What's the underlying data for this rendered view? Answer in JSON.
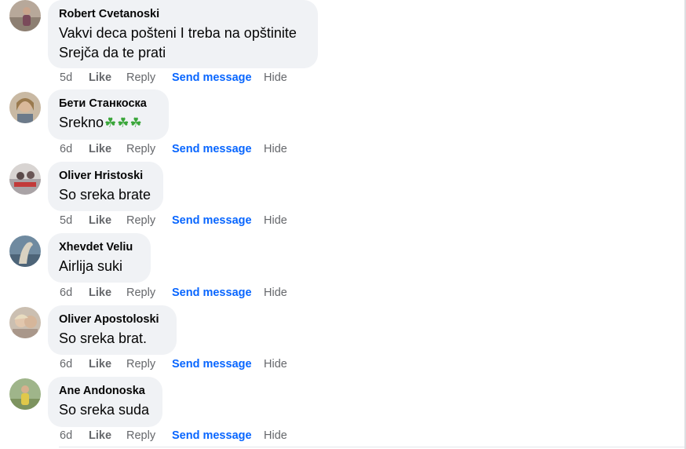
{
  "colors": {
    "bubble_bg": "#f0f2f5",
    "meta_text": "#65676b",
    "link_blue": "#0866ff"
  },
  "comments": [
    {
      "author": "Robert Cvetanoski",
      "lines": [
        "Vakvi deca pošteni I treba na opštinite",
        "Srejča da te prati"
      ],
      "time": "5d",
      "actions": {
        "like": "Like",
        "reply": "Reply",
        "send": "Send message",
        "hide": "Hide"
      }
    },
    {
      "author": "Бети Станкоска",
      "lines": [
        "Srekno"
      ],
      "emoji": [
        "☘",
        "☘",
        "☘"
      ],
      "emoji_names": "four-leaf-clover-icon",
      "time": "6d",
      "actions": {
        "like": "Like",
        "reply": "Reply",
        "send": "Send message",
        "hide": "Hide"
      }
    },
    {
      "author": "Oliver Hristoski",
      "lines": [
        "So sreka brate"
      ],
      "time": "5d",
      "actions": {
        "like": "Like",
        "reply": "Reply",
        "send": "Send message",
        "hide": "Hide"
      }
    },
    {
      "author": "Xhevdet Veliu",
      "lines": [
        "Airlija suki"
      ],
      "time": "6d",
      "actions": {
        "like": "Like",
        "reply": "Reply",
        "send": "Send message",
        "hide": "Hide"
      }
    },
    {
      "author": "Oliver Apostoloski",
      "lines": [
        "So sreka brat."
      ],
      "time": "6d",
      "actions": {
        "like": "Like",
        "reply": "Reply",
        "send": "Send message",
        "hide": "Hide"
      }
    },
    {
      "author": "Ane Andonoska",
      "lines": [
        "So sreka suda"
      ],
      "time": "6d",
      "actions": {
        "like": "Like",
        "reply": "Reply",
        "send": "Send message",
        "hide": "Hide"
      }
    }
  ]
}
